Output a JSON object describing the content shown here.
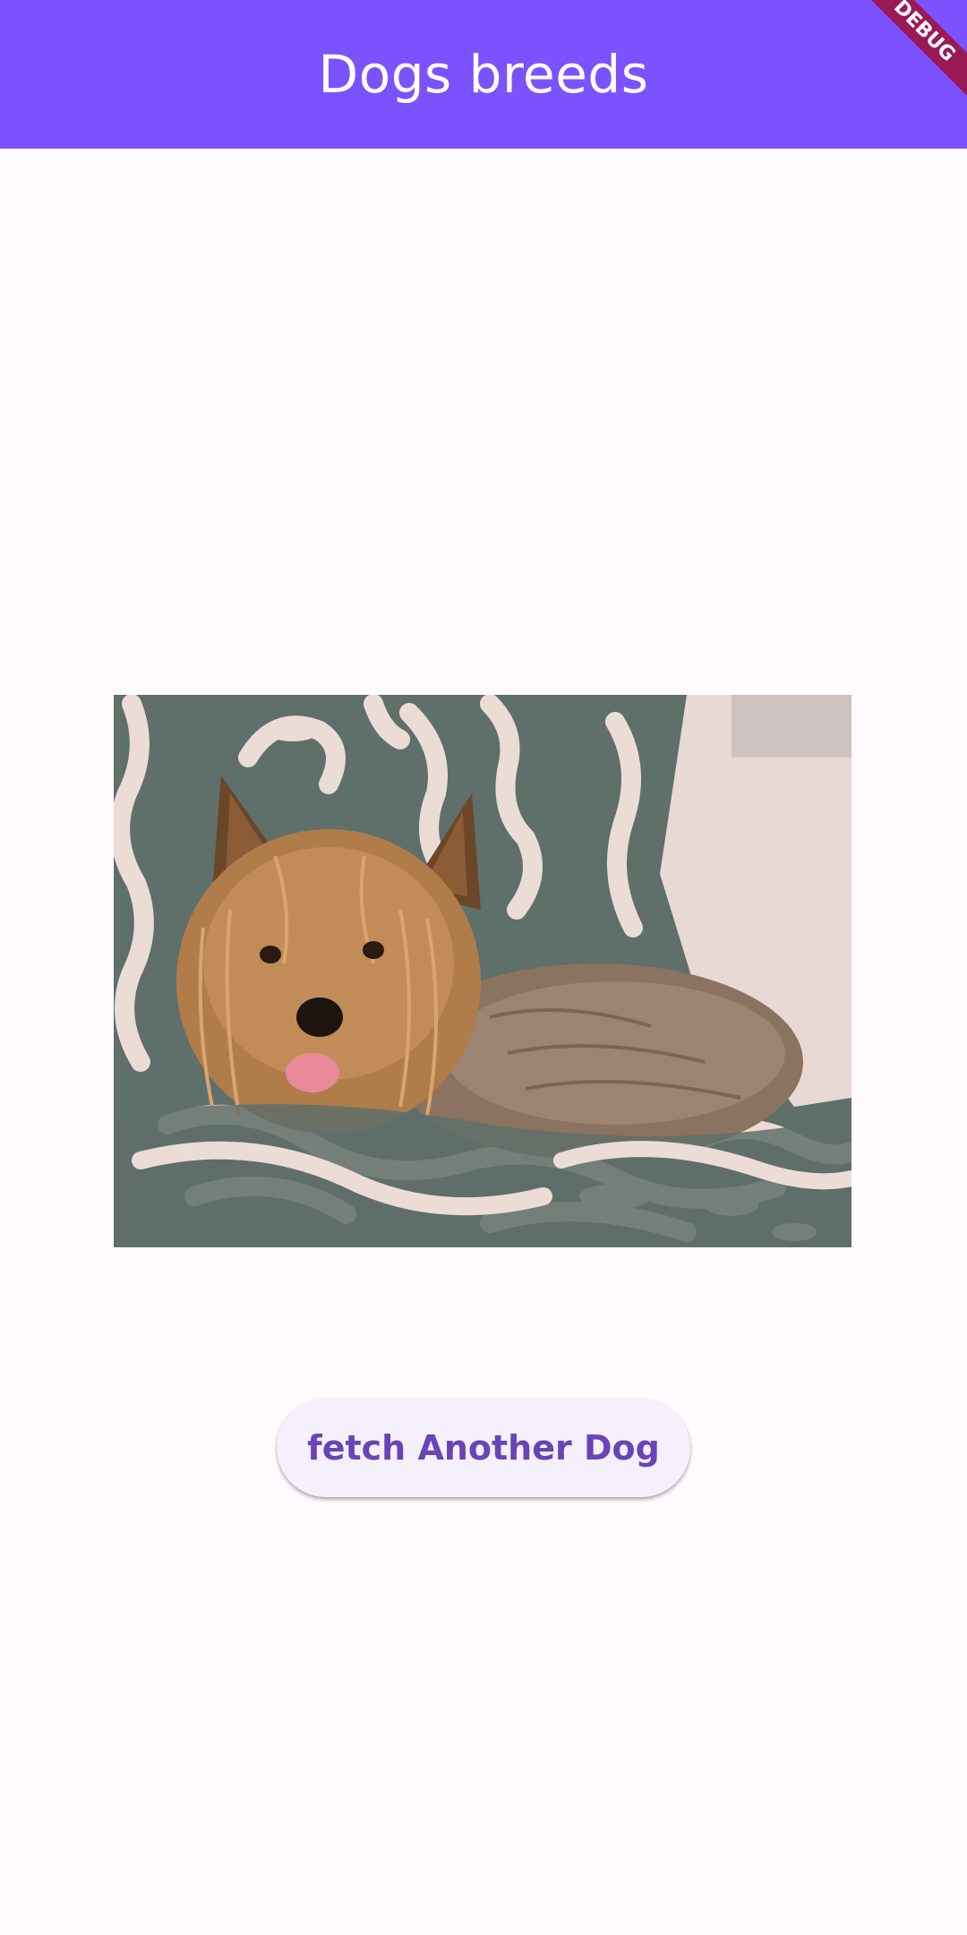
{
  "app_bar": {
    "title": "Dogs breeds",
    "background_color": "#7c52fe"
  },
  "debug_banner": {
    "label": "DEBUG",
    "color": "#9a1a55"
  },
  "content": {
    "dog_image": {
      "subject": "yorkshire-terrier"
    },
    "fetch_button": {
      "label": "fetch Another Dog",
      "text_color": "#6a44b6"
    }
  }
}
